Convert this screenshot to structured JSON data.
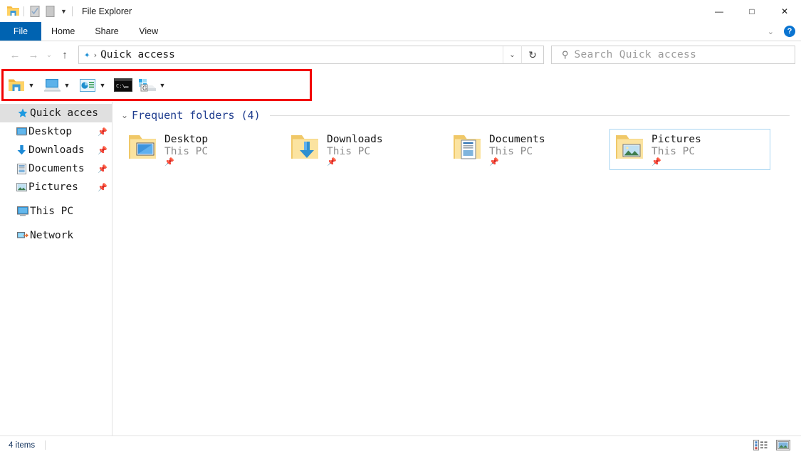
{
  "window": {
    "title": "File Explorer",
    "quick_access_toolbar": [
      {
        "name": "explorer-icon",
        "label": "File Explorer"
      },
      {
        "name": "properties-icon",
        "label": "Properties"
      },
      {
        "name": "new-folder-icon",
        "label": "New folder"
      },
      {
        "name": "customize-caret",
        "label": "Customize Quick Access Toolbar"
      }
    ],
    "controls": {
      "minimize": "—",
      "maximize": "□",
      "close": "✕"
    }
  },
  "ribbon": {
    "tabs": [
      {
        "label": "File",
        "active": true
      },
      {
        "label": "Home",
        "active": false
      },
      {
        "label": "Share",
        "active": false
      },
      {
        "label": "View",
        "active": false
      }
    ],
    "expand_caret": "⌄",
    "help_label": "?"
  },
  "address_bar": {
    "back": "←",
    "forward": "→",
    "recent": "⌄",
    "up": "↑",
    "path_icon": "quick-access-star-icon",
    "path_text": "Quick access",
    "crumb_separator": "›",
    "dropdown": "⌄",
    "refresh": "↻"
  },
  "search": {
    "icon": "search-icon",
    "placeholder": "Search Quick access"
  },
  "toolbar": {
    "highlight_color": "#f20000",
    "buttons": [
      {
        "name": "open-folder-button",
        "icon": "folder-icon",
        "has_caret": true
      },
      {
        "name": "open-computer-button",
        "icon": "computer-icon",
        "has_caret": true
      },
      {
        "name": "properties-button",
        "icon": "properties-panel-icon",
        "has_caret": true
      },
      {
        "name": "command-prompt-button",
        "icon": "command-prompt-icon",
        "has_caret": false
      },
      {
        "name": "map-network-drive-button",
        "icon": "network-drive-icon",
        "has_caret": true
      }
    ],
    "caret": "▼"
  },
  "sidebar": {
    "items": [
      {
        "label": "Quick acces",
        "icon": "star-icon",
        "level": 0,
        "selected": true,
        "pinned": false
      },
      {
        "label": "Desktop",
        "icon": "desktop-icon",
        "level": 1,
        "selected": false,
        "pinned": true
      },
      {
        "label": "Downloads",
        "icon": "download-icon",
        "level": 1,
        "selected": false,
        "pinned": true
      },
      {
        "label": "Documents",
        "icon": "document-icon",
        "level": 1,
        "selected": false,
        "pinned": true
      },
      {
        "label": "Pictures",
        "icon": "picture-icon",
        "level": 1,
        "selected": false,
        "pinned": true
      },
      {
        "label": "This PC",
        "icon": "this-pc-icon",
        "level": 0,
        "selected": false,
        "pinned": false
      },
      {
        "label": "Network",
        "icon": "network-icon",
        "level": 0,
        "selected": false,
        "pinned": false
      }
    ],
    "pin_glyph": "📌"
  },
  "content": {
    "group": {
      "chevron": "⌄",
      "title": "Frequent folders (4)"
    },
    "tiles": [
      {
        "name": "Desktop",
        "location": "This PC",
        "icon": "folder-desktop-icon",
        "pinned": true,
        "selected": false
      },
      {
        "name": "Downloads",
        "location": "This PC",
        "icon": "folder-downloads-icon",
        "pinned": true,
        "selected": false
      },
      {
        "name": "Documents",
        "location": "This PC",
        "icon": "folder-documents-icon",
        "pinned": true,
        "selected": false
      },
      {
        "name": "Pictures",
        "location": "This PC",
        "icon": "folder-pictures-icon",
        "pinned": true,
        "selected": true
      }
    ]
  },
  "statusbar": {
    "item_count": "4 items",
    "views": [
      {
        "name": "details-view-button",
        "label": "Details view"
      },
      {
        "name": "large-icons-view-button",
        "label": "Large icons view"
      }
    ]
  }
}
